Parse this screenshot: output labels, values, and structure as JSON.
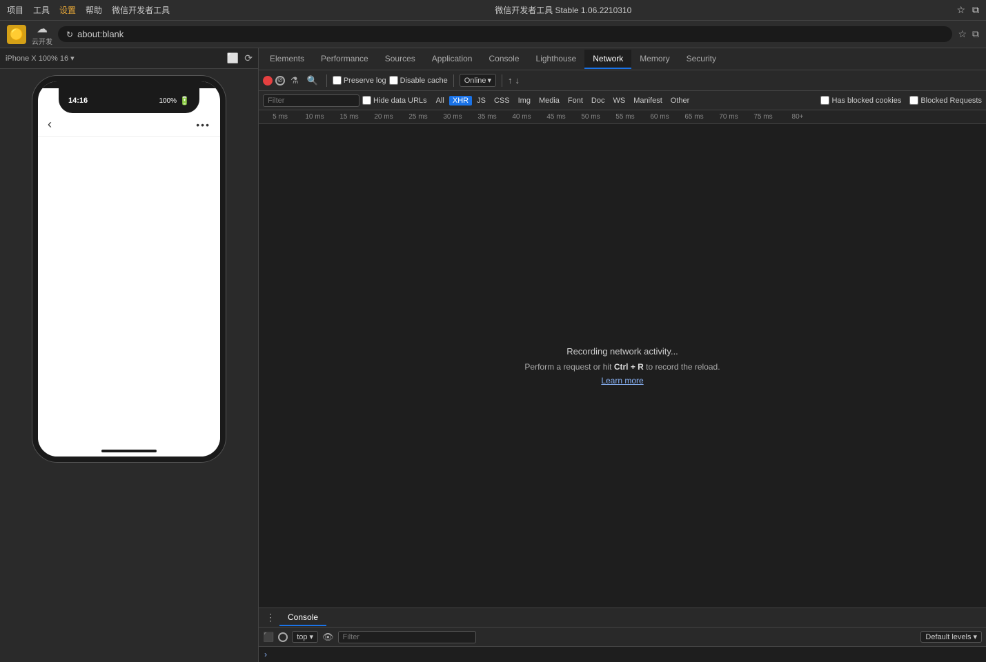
{
  "titleBar": {
    "menuItems": [
      "项目",
      "工具",
      "设置",
      "帮助",
      "微信开发者工具"
    ],
    "centerText": "微信开发者工具 Stable 1.06.2210310",
    "rightIcons": [
      "star",
      "layers"
    ]
  },
  "addressBar": {
    "logoEmoji": "🟡",
    "cloudLabel": "云开发",
    "refreshIcon": "↻",
    "url": "about:blank",
    "starIcon": "☆",
    "layersIcon": "⧉"
  },
  "phonePanel": {
    "topBarLabel": "iPhone X 100% 16 ▾",
    "deviceIcon": "⬜",
    "settingsIcon": "⚙",
    "statusTime": "14:16",
    "statusRight": "100%",
    "backArrow": "‹",
    "moreBtn": "•••"
  },
  "devtools": {
    "tabs": [
      {
        "id": "elements",
        "label": "Elements",
        "active": false
      },
      {
        "id": "performance",
        "label": "Performance",
        "active": false
      },
      {
        "id": "sources",
        "label": "Sources",
        "active": false
      },
      {
        "id": "application",
        "label": "Application",
        "active": false
      },
      {
        "id": "console",
        "label": "Console",
        "active": false
      },
      {
        "id": "lighthouse",
        "label": "Lighthouse",
        "active": false
      },
      {
        "id": "network",
        "label": "Network",
        "active": true
      },
      {
        "id": "memory",
        "label": "Memory",
        "active": false
      },
      {
        "id": "security",
        "label": "Security",
        "active": false
      }
    ],
    "network": {
      "recordLabel": "Record",
      "clearLabel": "Clear",
      "filterLabel": "Filter",
      "searchLabel": "Search",
      "preserveLogLabel": "Preserve log",
      "disableCacheLabel": "Disable cache",
      "throttleLabel": "Online",
      "uploadIcon": "↑",
      "downloadIcon": "↓",
      "filterBarLabel": "Filter",
      "hideDateURLsLabel": "Hide data URLs",
      "filterTags": [
        {
          "id": "all",
          "label": "All"
        },
        {
          "id": "xhr",
          "label": "XHR",
          "active": true
        },
        {
          "id": "js",
          "label": "JS"
        },
        {
          "id": "css",
          "label": "CSS"
        },
        {
          "id": "img",
          "label": "Img"
        },
        {
          "id": "media",
          "label": "Media"
        },
        {
          "id": "font",
          "label": "Font"
        },
        {
          "id": "doc",
          "label": "Doc"
        },
        {
          "id": "ws",
          "label": "WS"
        },
        {
          "id": "manifest",
          "label": "Manifest"
        },
        {
          "id": "other",
          "label": "Other"
        }
      ],
      "hasBlockedLabel": "Has blocked cookies",
      "blockedRequestsLabel": "Blocked Requests",
      "rulerTicks": [
        "5 ms",
        "10 ms",
        "15 ms",
        "20 ms",
        "25 ms",
        "30 ms",
        "35 ms",
        "40 ms",
        "45 ms",
        "50 ms",
        "55 ms",
        "60 ms",
        "65 ms",
        "70 ms",
        "75 ms",
        "80+"
      ],
      "recordingText": "Recording network activity...",
      "recordingSub": "Perform a request or hit ",
      "recordingKey": "Ctrl + R",
      "recordingEnd": " to record the reload.",
      "learnMore": "Learn more"
    },
    "console": {
      "menuIcon": "⋮",
      "tabLabel": "Console",
      "sidebarIcon": "⬛",
      "clearIcon": "🚫",
      "contextLabel": "top",
      "contextArrow": "▾",
      "eyeIcon": "👁",
      "filterPlaceholder": "Filter",
      "defaultLevelsLabel": "Default levels",
      "defaultLevelsArrow": "▾",
      "promptArrow": "›"
    }
  }
}
